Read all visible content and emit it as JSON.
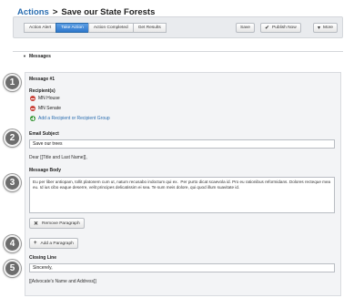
{
  "header": {
    "breadcrumb_link": "Actions",
    "separator": ">",
    "page_title": "Save our State Forests"
  },
  "toolbar": {
    "tabs": [
      {
        "label": "Action Alert"
      },
      {
        "label": "Take Action"
      },
      {
        "label": "Action Completed"
      },
      {
        "label": "Get Results"
      }
    ],
    "active_tab": "Take Action",
    "save_label": "Save",
    "publish_label": "Publish Now",
    "more_label": "More"
  },
  "messages_section": {
    "title": "Messages",
    "message_heading": "Message #1",
    "recipients_label": "Recipient(s)",
    "recipients": [
      {
        "name": "MN House"
      },
      {
        "name": "MN Senate"
      }
    ],
    "add_recipient_label": "Add a Recipient  or Recipient  Group",
    "email_subject_label": "Email Subject",
    "email_subject_value": "Save our trees",
    "salutation": "Dear [[Title and Last Name]],",
    "message_body_label": "Message Body",
    "message_body_value": "Eu per liber antiopam, tollit platonem cum ut, natum recusabo indoctum qui ex.  Per purto dicat scaevola id. Pro eu rationibus reformidans. Dolores recteque mea eu. Id ius cibo eaque deserre, velit principes delicatissim ei sea. Te sum meis dolore, qui quod illum suavitate id.",
    "remove_paragraph_label": "Remove Paragraph",
    "add_paragraph_label": "Add a Paragraph",
    "closing_line_label": "Closing Line",
    "closing_line_value": "Sincerely,",
    "signature": "[[Advocate's Name and Address]]"
  },
  "callouts": [
    "1",
    "2",
    "3",
    "4",
    "5"
  ],
  "colors": {
    "link": "#2a6db0",
    "active_tab": "#3a83d6",
    "remove_icon": "#c9423a",
    "add_icon": "#3f9a3f",
    "callout": "#6d6d6d"
  }
}
